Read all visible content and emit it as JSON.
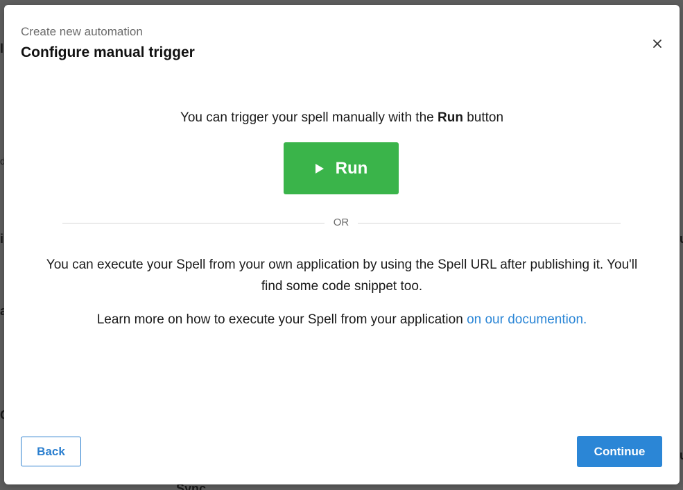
{
  "background": {
    "fragments": [
      "l",
      "d",
      "i",
      "a",
      "C",
      "Sync",
      "u",
      "u"
    ]
  },
  "modal": {
    "subtitle": "Create new automation",
    "title": "Configure manual trigger",
    "close_icon": "close-icon"
  },
  "content": {
    "intro_before": "You can trigger your spell manually with the ",
    "intro_bold": "Run",
    "intro_after": " button",
    "run_button": {
      "label": "Run",
      "icon": "play-icon",
      "color": "#3ab44a"
    },
    "divider_label": "OR",
    "exec_text": "You can execute your Spell from your own application by using the Spell URL after publishing it. You'll find some code snippet too.",
    "learn_text": "Learn more on how to execute your Spell from your application ",
    "learn_link": "on our documention."
  },
  "footer": {
    "back_label": "Back",
    "continue_label": "Continue"
  },
  "colors": {
    "accent": "#2b86d6",
    "run_green": "#3ab44a",
    "overlay": "#5e5e5e"
  }
}
